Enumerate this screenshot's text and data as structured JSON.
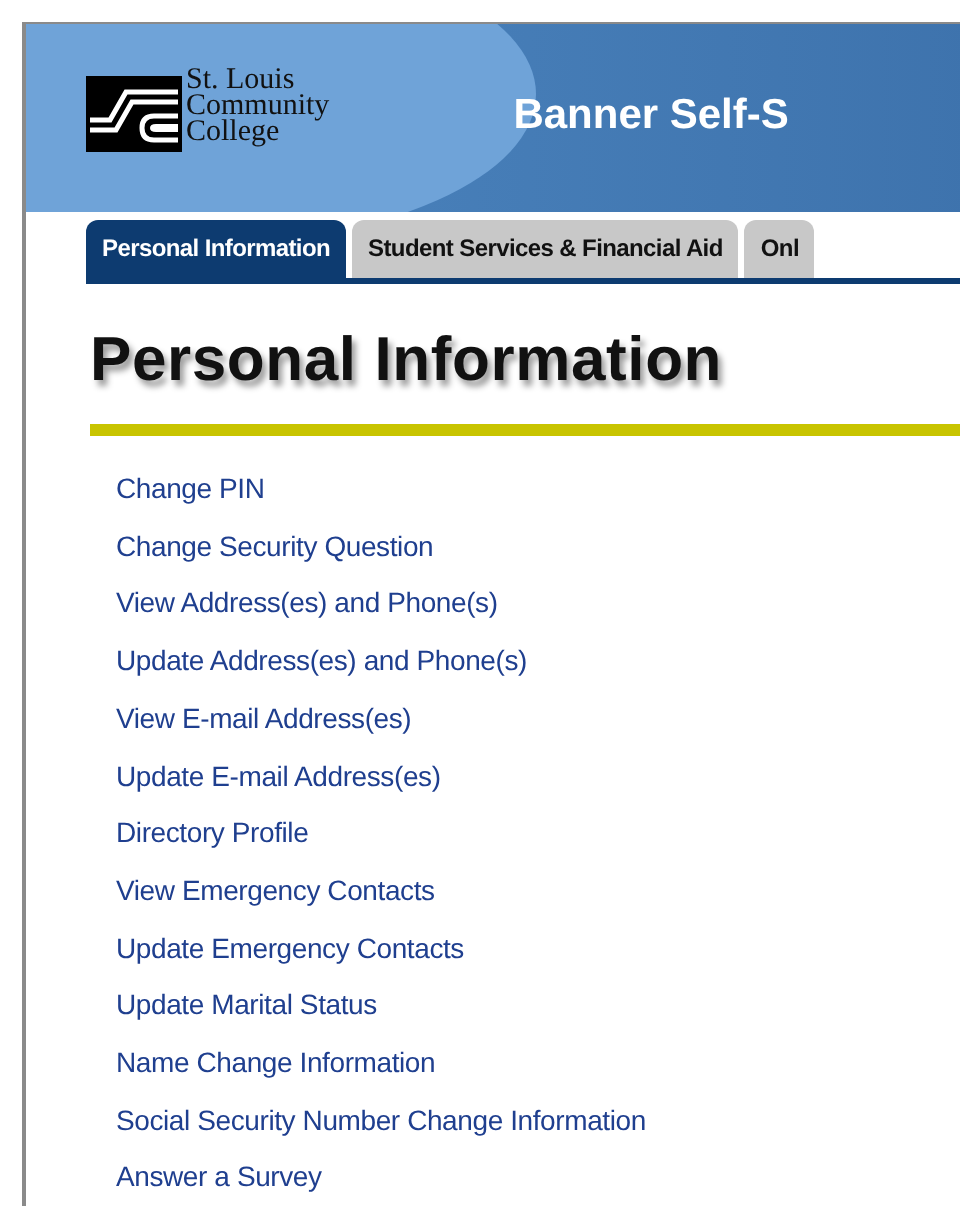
{
  "header": {
    "logo_lines": [
      "St. Louis",
      "Community",
      "College"
    ],
    "title": "Banner Self-S"
  },
  "tabs": [
    {
      "label": "Personal Information",
      "selected": true
    },
    {
      "label": "Student Services & Financial Aid",
      "selected": false
    },
    {
      "label": "Onl",
      "selected": false
    }
  ],
  "page_title": "Personal Information",
  "links": [
    "Change PIN",
    "Change Security Question",
    "View Address(es) and Phone(s)",
    "Update Address(es) and Phone(s)",
    "View E-mail Address(es)",
    "Update E-mail Address(es)",
    "Directory Profile",
    "View Emergency Contacts",
    "Update Emergency Contacts",
    "Update Marital Status",
    "Name Change Information",
    "Social Security Number Change Information",
    "Answer a Survey"
  ]
}
